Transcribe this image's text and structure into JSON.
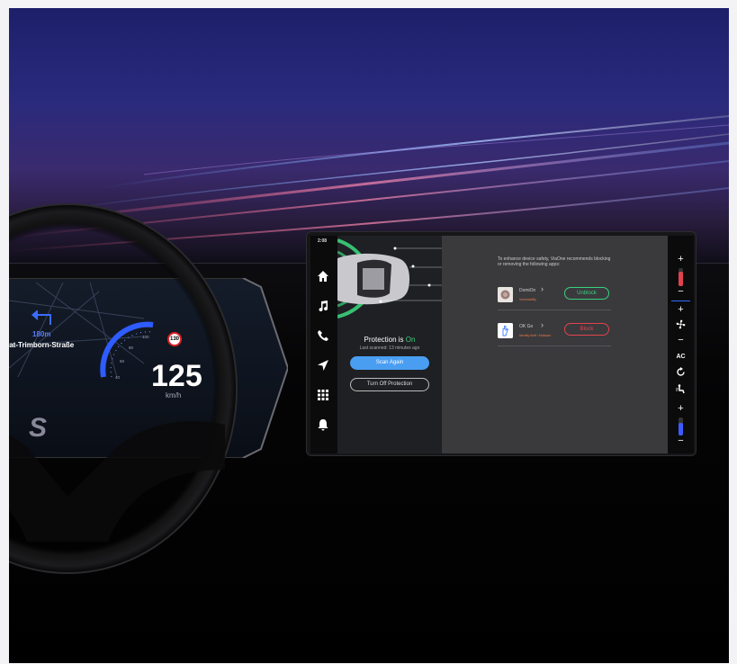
{
  "cluster": {
    "distance": "180m",
    "street": "Landrat-Trimborn-Straße",
    "speed": "125",
    "speed_unit": "km/h",
    "speed_limit": "130",
    "gauge_ticks": [
      "40",
      "60",
      "80",
      "100"
    ],
    "brand_letter": "S"
  },
  "head_unit": {
    "time": "2:08",
    "nav_icons": [
      "home-icon",
      "music-icon",
      "phone-icon",
      "navigation-icon",
      "apps-grid-icon",
      "bell-icon"
    ],
    "protection": {
      "label": "Protection is ",
      "status": "On",
      "last_scanned": "Last scanned: 13 minutes ago",
      "scan_button": "Scan Again",
      "turn_off_button": "Turn Off Protection"
    },
    "recommendation": {
      "intro": "To enhance device safety, ViaOne recommends blocking or removing the following apps:",
      "apps": [
        {
          "name": "DomiOn",
          "risk": "Vulnerability",
          "action": "Unblock"
        },
        {
          "name": "OK Go",
          "risk": "Identity theft / Malware",
          "action": "Block"
        }
      ]
    },
    "climate": {
      "plus": "+",
      "minus": "−",
      "ac": "AC"
    }
  },
  "colors": {
    "accent_blue": "#4a9ef2",
    "safe_green": "#3ad17c",
    "danger_red": "#e0434e"
  }
}
